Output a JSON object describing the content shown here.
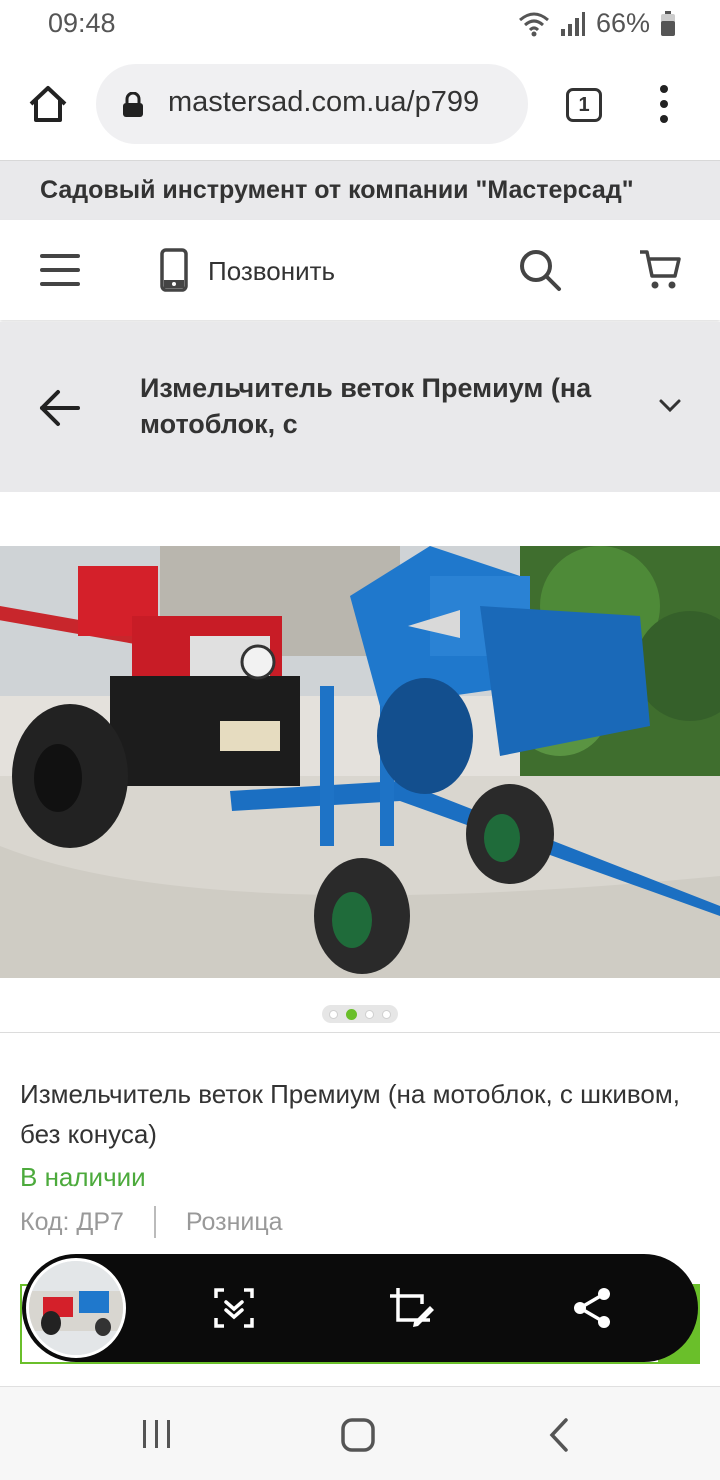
{
  "status_bar": {
    "time": "09:48",
    "battery": "66%"
  },
  "browser": {
    "url": "mastersad.com.ua/p799",
    "tab_count": "1"
  },
  "site": {
    "banner": "Садовый инструмент от компании \"Мастерсад\""
  },
  "header": {
    "call_label": "Позвонить"
  },
  "title_bar": {
    "title": "Измельчитель веток Премиум (на мотоблок, с"
  },
  "carousel": {
    "count": 4,
    "active_index": 1
  },
  "product": {
    "name": "Измельчитель веток Премиум (на мотоблок, с шкивом, без конуса)",
    "availability": "В наличии",
    "code": "Код: ДР7",
    "price_type": "Розница"
  },
  "colors": {
    "accent_green": "#6abf2a",
    "stock_green": "#4caa3c",
    "machine_red": "#d4202a",
    "machine_blue": "#1b6fc2"
  }
}
